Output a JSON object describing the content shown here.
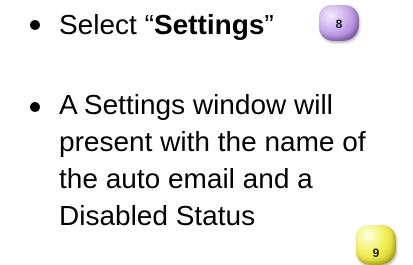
{
  "bullets": [
    {
      "prefix": "Select “",
      "bold": "Settings",
      "suffix": "”",
      "badge": {
        "number": "8",
        "color": "#a57fd6"
      }
    },
    {
      "lines": [
        "A Settings window will",
        "present with the name of",
        "the auto email and a",
        "Disabled Status"
      ],
      "badge": {
        "number": "9",
        "color": "#ece63a"
      }
    }
  ]
}
